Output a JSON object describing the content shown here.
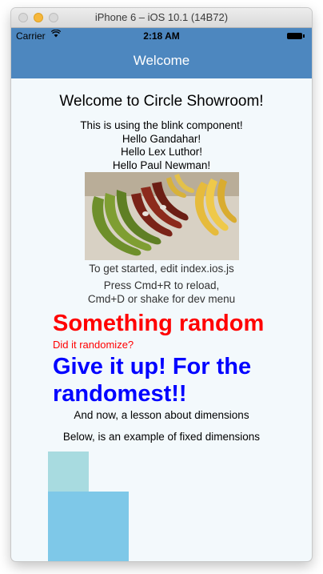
{
  "window": {
    "title": "iPhone 6 – iOS 10.1 (14B72)"
  },
  "status_bar": {
    "carrier": "Carrier",
    "time": "2:18 AM"
  },
  "nav": {
    "title": "Welcome"
  },
  "main": {
    "heading": "Welcome to Circle Showroom!",
    "blink_line": "This is using the blink component!",
    "greetings": [
      "Hello Gandahar!",
      "Hello Lex Luthor!",
      "Hello Paul Newman!"
    ],
    "get_started": "To get started, edit index.ios.js",
    "reload_line1": "Press Cmd+R to reload,",
    "reload_line2": "Cmd+D or shake for dev menu",
    "random_title": "Something random",
    "random_sub": "Did it randomize?",
    "give_up": "Give it up! For the randomest!!",
    "lesson": "And now, a lesson about dimensions",
    "fixed": "Below, is an example of fixed dimensions"
  },
  "colors": {
    "nav_bg": "#4d87bf",
    "content_bg": "#f3f9fc",
    "random_red": "#ff0000",
    "give_up_blue": "#0000ff",
    "box_light": "#a8dbe0",
    "box_mid": "#7ec8e8"
  },
  "icons": [
    "wifi-icon",
    "battery-icon",
    "bananas-photo"
  ]
}
